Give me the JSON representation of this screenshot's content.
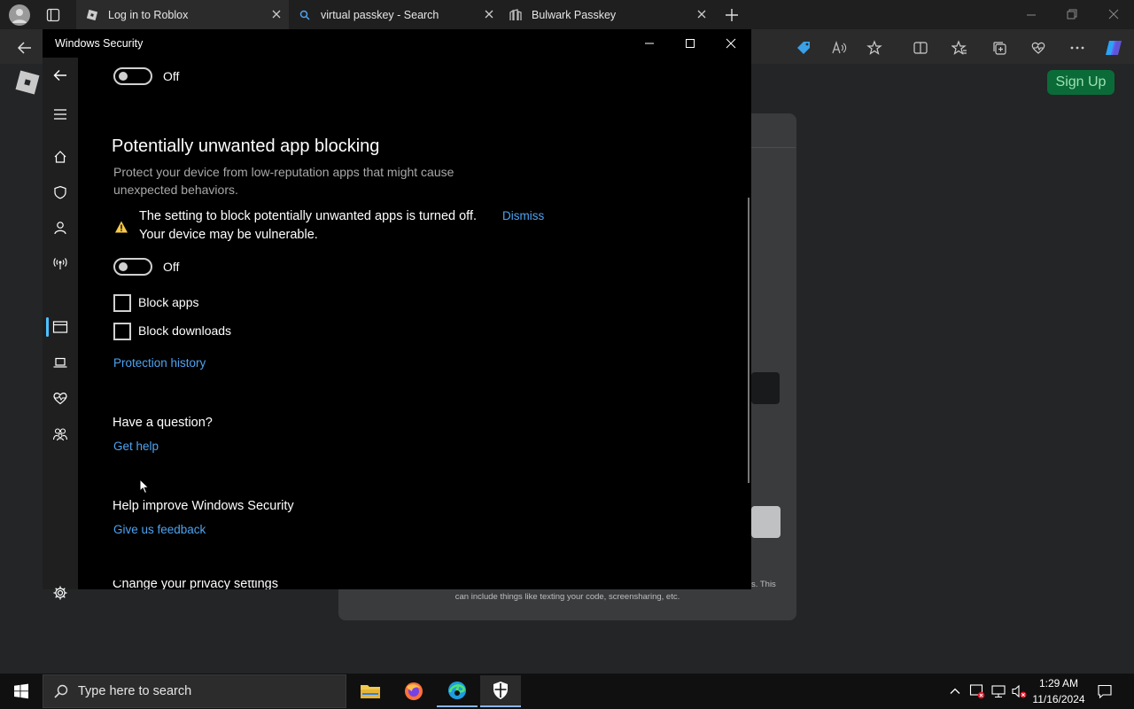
{
  "browser": {
    "tabs": [
      {
        "title": "Log in to Roblox",
        "active": true
      },
      {
        "title": "virtual passkey - Search",
        "active": false
      },
      {
        "title": "Bulwark Passkey",
        "active": false
      }
    ]
  },
  "webpage": {
    "signup_label": "Sign Up",
    "note_text": "can include things like texting your code, screensharing, etc.",
    "note_right": "s. This"
  },
  "security_window": {
    "title": "Windows Security",
    "top_toggle_label": "Off",
    "section_title": "Potentially unwanted app blocking",
    "section_desc": "Protect your device from low-reputation apps that might cause unexpected behaviors.",
    "warning_line1": "The setting to block potentially unwanted apps is turned off.",
    "warning_line2": "Your device may be vulnerable.",
    "dismiss_label": "Dismiss",
    "toggle_label": "Off",
    "checkbox_block_apps": "Block apps",
    "checkbox_block_downloads": "Block downloads",
    "protection_history_link": "Protection history",
    "question_heading": "Have a question?",
    "get_help_link": "Get help",
    "improve_heading": "Help improve Windows Security",
    "feedback_link": "Give us feedback",
    "privacy_heading": "Change your privacy settings"
  },
  "taskbar": {
    "search_placeholder": "Type here to search",
    "time": "1:29 AM",
    "date": "11/16/2024"
  },
  "colors": {
    "accent_link": "#4ea3f0",
    "warning": "#f7c948",
    "signup_bg": "#0b6b38"
  }
}
